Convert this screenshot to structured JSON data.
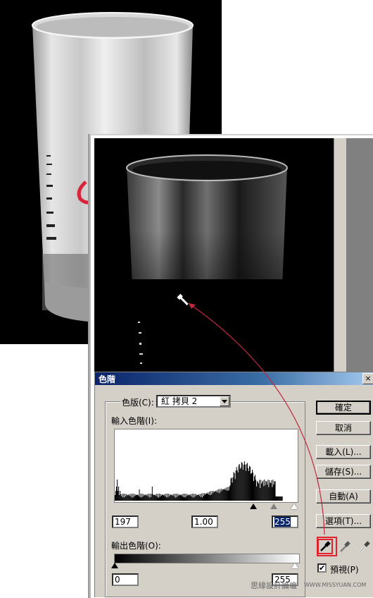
{
  "dialog": {
    "title": "色階",
    "close_label": "×",
    "channel_label": "色版(C):",
    "channel_value": "紅 拷貝 2",
    "input_label": "輸入色階(I):",
    "input_black": "197",
    "input_gamma": "1.00",
    "input_white": "255",
    "output_label": "輸出色階(O):",
    "output_black": "0",
    "output_white": "255",
    "buttons": {
      "ok": "確定",
      "cancel": "取消",
      "load": "載入(L)...",
      "save": "儲存(S)...",
      "auto": "自動(A)",
      "options": "選項(T)..."
    },
    "preview_label": "預視(P)",
    "preview_checked": true,
    "active_dropper": "black-point-eyedropper"
  },
  "colors": {
    "titlebar_start": "#0a246a",
    "titlebar_end": "#a6caf0",
    "dialog_bg": "#d4d0c8",
    "highlight_red": "#e0232f",
    "arrow_line": "#c0283c"
  },
  "watermark": {
    "text": "思緣設計論壇",
    "url": "WWW.MISSYUAN.COM"
  }
}
